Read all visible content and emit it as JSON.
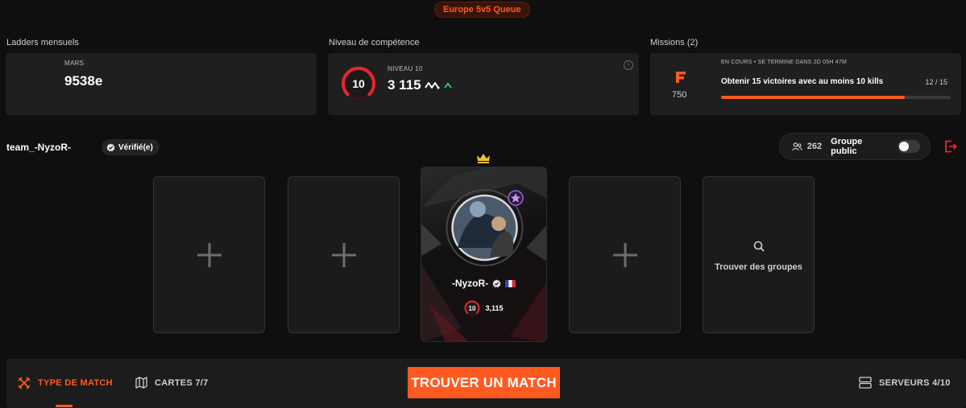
{
  "queue": {
    "label": "Europe 5v5 Queue"
  },
  "ladders": {
    "section_label": "Ladders mensuels",
    "month": "MARS",
    "rank": "9538e"
  },
  "skill": {
    "section_label": "Niveau de compétence",
    "level_label": "NIVEAU 10",
    "level": "10",
    "elo": "3 115",
    "trend": "up",
    "level_color": "#e8262f"
  },
  "missions": {
    "section_label": "Missions (2)",
    "status": "EN COURS • SE TERMINE DANS 2D 05H 47M",
    "title": "Obtenir 15 victoires avec au moins 10 kills",
    "progress_text": "12 / 15",
    "progress_fraction": 0.8,
    "points": "750",
    "logo_letter": "F"
  },
  "team": {
    "name": "team_-NyzoR-",
    "verified_label": "Vérifié(e)"
  },
  "group": {
    "count": "262",
    "label": "Groupe public",
    "public_enabled": false
  },
  "slots": {
    "find_groups_label": "Trouver des groupes"
  },
  "player": {
    "name": "-NyzoR-",
    "level": "10",
    "elo": "3,115",
    "country": "FR"
  },
  "bottom": {
    "match_type_label": "TYPE DE MATCH",
    "maps_label": "CARTES 7/7",
    "find_match_label": "TROUVER UN MATCH",
    "servers_label": "SERVEURS 4/10"
  },
  "colors": {
    "accent": "#ff5a1f",
    "card_bg": "#1f1f1f",
    "page_bg": "#0f0f0f"
  }
}
